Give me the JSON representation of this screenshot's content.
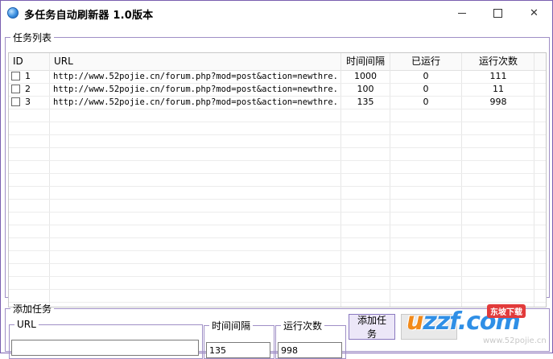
{
  "window": {
    "title": "多任务自动刷新器 1.0版本",
    "controls": [
      "minimize",
      "maximize",
      "close"
    ]
  },
  "task_list": {
    "legend": "任务列表",
    "columns": [
      "ID",
      "URL",
      "时间间隔",
      "已运行",
      "运行次数"
    ],
    "rows": [
      {
        "id": "1",
        "url": "http://www.52pojie.cn/forum.php?mod=post&action=newthre...",
        "interval": "1000",
        "ran": "0",
        "count": "111"
      },
      {
        "id": "2",
        "url": "http://www.52pojie.cn/forum.php?mod=post&action=newthre...",
        "interval": "100",
        "ran": "0",
        "count": "11"
      },
      {
        "id": "3",
        "url": "http://www.52pojie.cn/forum.php?mod=post&action=newthre...",
        "interval": "135",
        "ran": "0",
        "count": "998"
      }
    ]
  },
  "add_task": {
    "legend": "添加任务",
    "url_label": "URL",
    "url_value": "",
    "interval_label": "时间间隔",
    "interval_value": "135",
    "count_label": "运行次数",
    "count_value": "998",
    "add_button": "添加任务"
  },
  "watermark": {
    "logo": "uzzf.com",
    "badge": "东坡下载",
    "url": "www.52pojie.cn"
  },
  "colors": {
    "window_border": "#7a5fb0",
    "group_border": "#9f8fc6",
    "button_bg": "#ece7f8"
  }
}
